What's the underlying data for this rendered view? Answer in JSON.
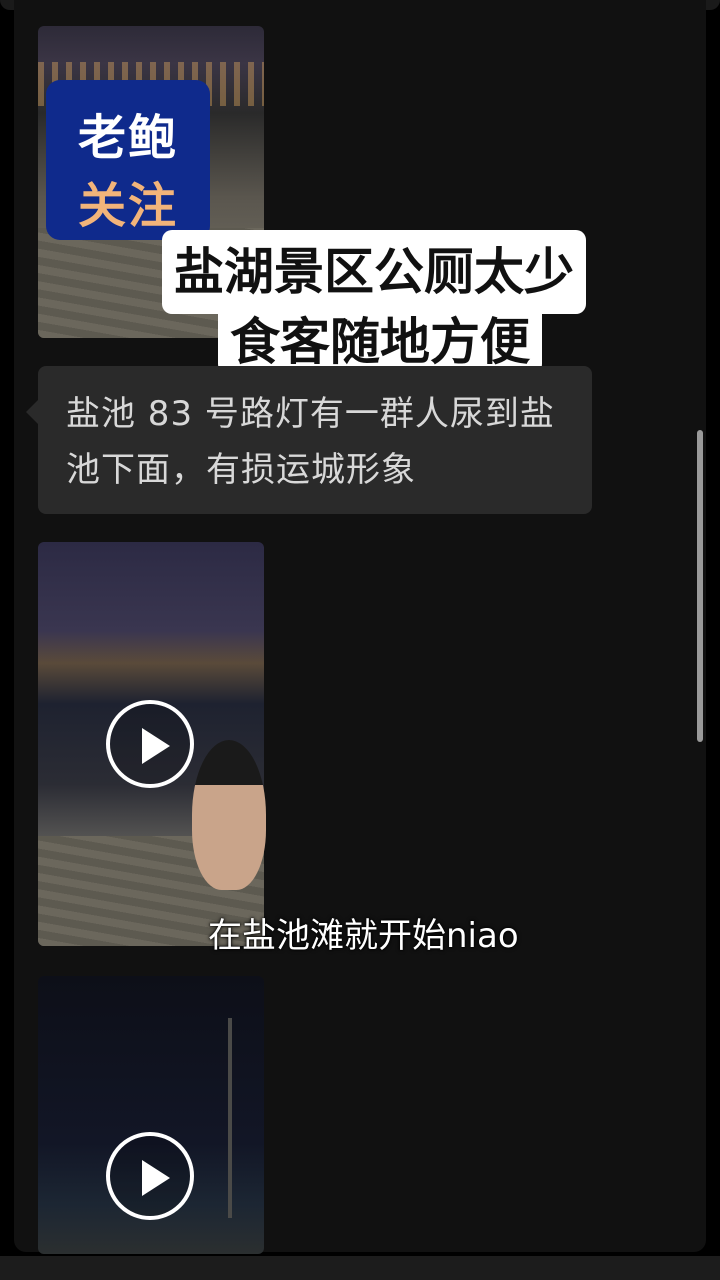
{
  "logo": {
    "line1": "老鲍",
    "line2": "关注"
  },
  "headline": {
    "line1": "盐湖景区公厕太少",
    "line2": "食客随地方便"
  },
  "message": {
    "text": "盐池 83 号路灯有一群人尿到盐池下面，有损运城形象"
  },
  "subtitle": {
    "text": "在盐池滩就开始niao"
  },
  "colors": {
    "background": "#111111",
    "logo_bg": "#0f2a8c",
    "logo_accent": "#f2b47a",
    "bubble": "#2a2a2a"
  },
  "icons": {
    "video1": "play-icon",
    "video2": "play-icon"
  }
}
